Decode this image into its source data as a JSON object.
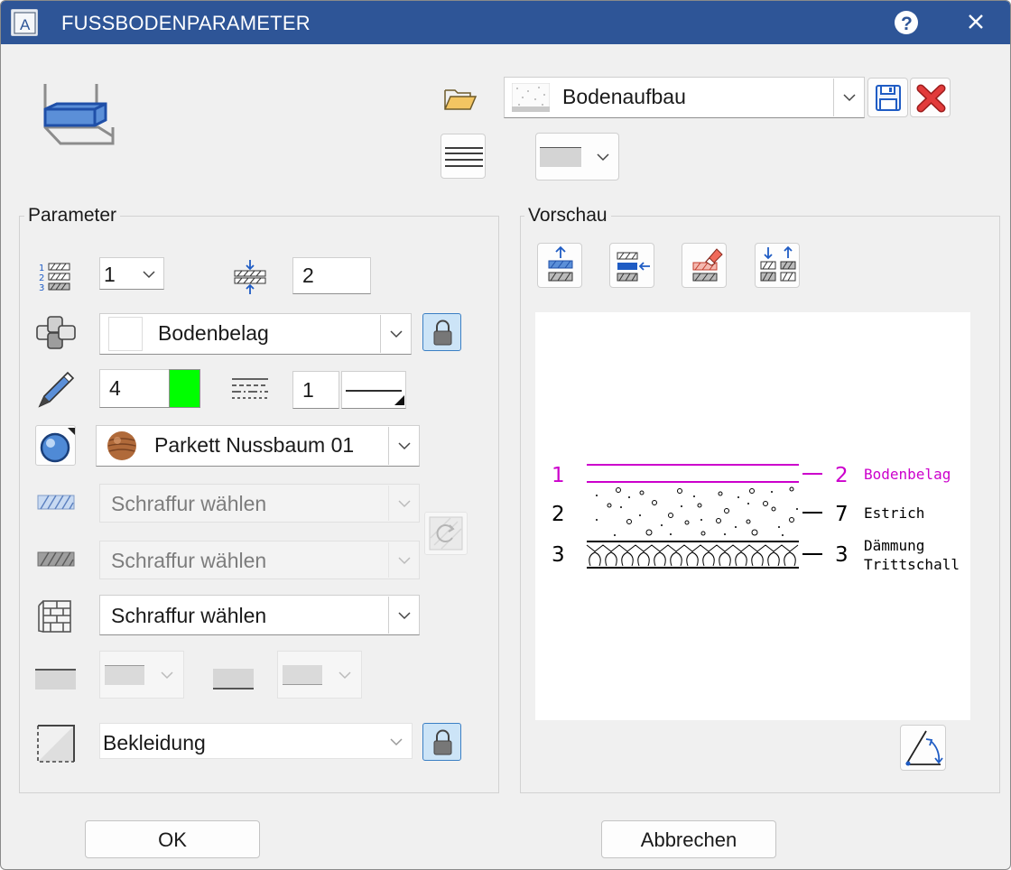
{
  "window": {
    "title": "FUSSBODENPARAMETER",
    "app_icon_letter": "A"
  },
  "header": {
    "favorite_combo": {
      "value": "Bodenaufbau"
    }
  },
  "parameter": {
    "title": "Parameter",
    "layer_number": "1",
    "thickness_value": "2",
    "layer_combo": "Bodenbelag",
    "pen_value": "4",
    "pen_color": "#00ff00",
    "linetype_value": "1",
    "surface_combo": "Parkett Nussbaum 01",
    "hatch1": "Schraffur wählen",
    "hatch2": "Schraffur wählen",
    "hatch3": "Schraffur wählen",
    "cladding_combo": "Bekleidung"
  },
  "preview": {
    "title": "Vorschau",
    "rows": [
      {
        "left": "1",
        "right_num": "2",
        "label": "Bodenbelag",
        "color": "#cc00cc"
      },
      {
        "left": "2",
        "right_num": "7",
        "label": "Estrich",
        "color": "#000000"
      },
      {
        "left": "3",
        "right_num": "3",
        "label": "Dämmung",
        "label2": "Trittschall",
        "color": "#000000"
      }
    ]
  },
  "buttons": {
    "ok": "OK",
    "cancel": "Abbrechen"
  },
  "colors": {
    "titlebar": "#2e5597",
    "accent_blue": "#1f5cc4",
    "lock_bg": "#cce4f7"
  }
}
